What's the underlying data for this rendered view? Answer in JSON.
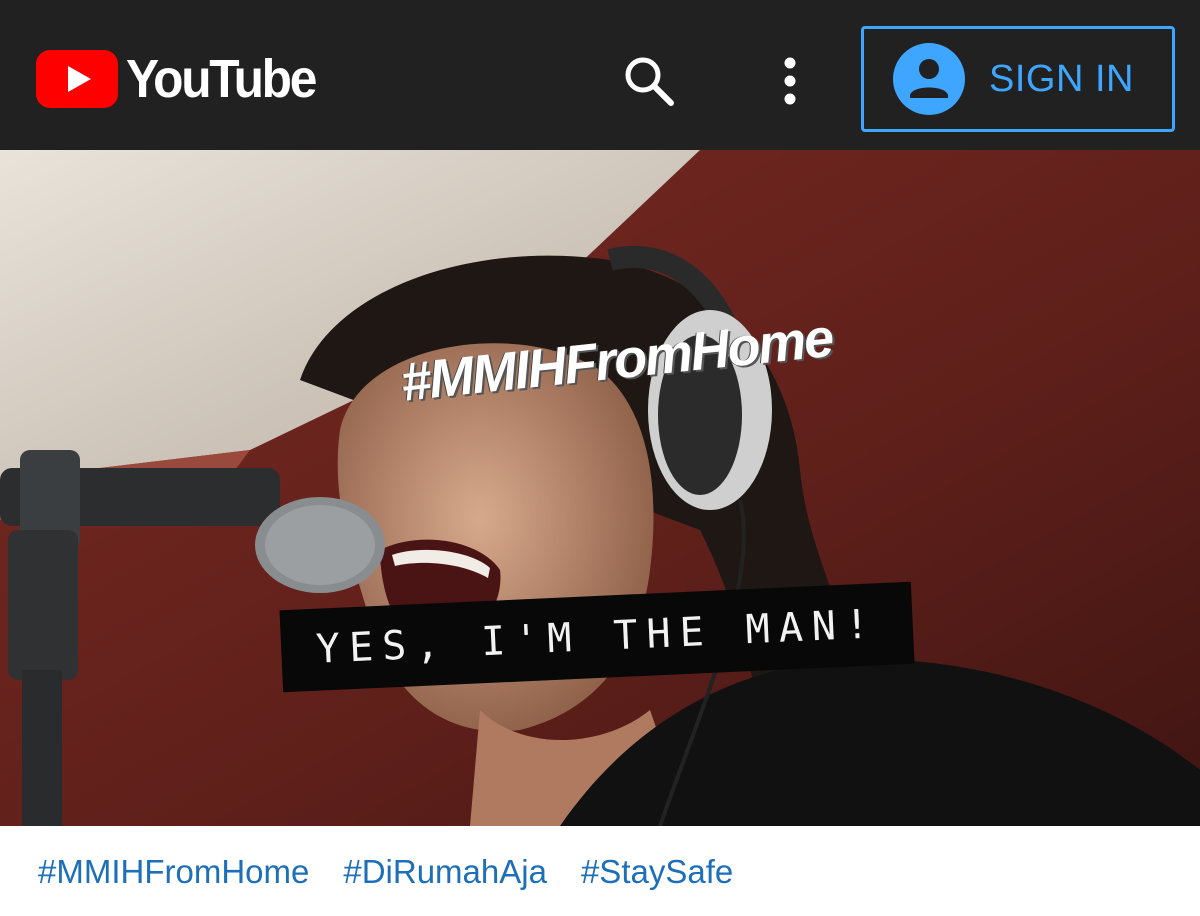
{
  "header": {
    "logo_text": "YouTube",
    "search_icon": "search-icon",
    "more_icon": "more-vert-icon",
    "signin_label": "SIGN IN",
    "signin_icon": "account-circle-icon",
    "accent_color": "#3ea6ff",
    "brand_red": "#ff0000",
    "bar_color": "#212121"
  },
  "video": {
    "overlay_title": "#MMIHFromHome",
    "caption": "YES, I'M THE MAN!"
  },
  "hashtags": [
    "#MMIHFromHome",
    "#DiRumahAja",
    "#StaySafe"
  ],
  "hashtag_color": "#1c6fb8"
}
